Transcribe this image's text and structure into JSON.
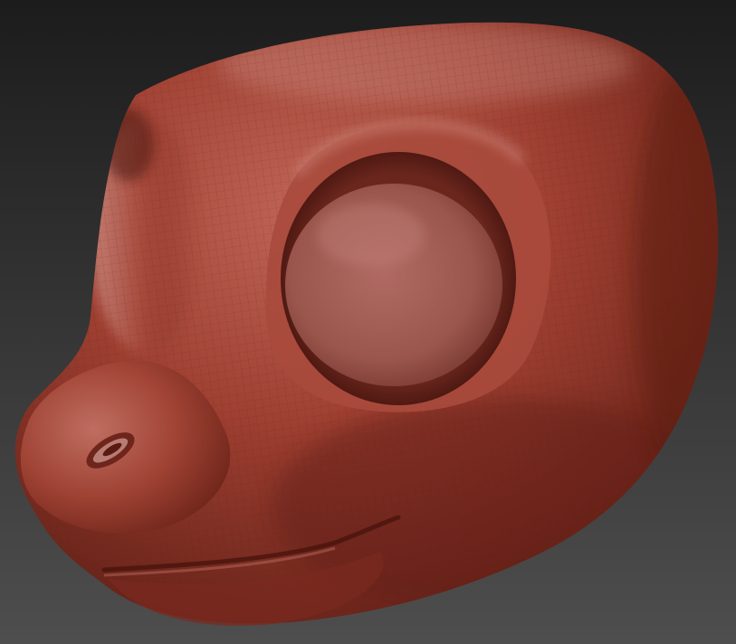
{
  "viewport": {
    "background_top": "#1c1c1c",
    "background_bottom": "#4e4e4e"
  },
  "model": {
    "material_base": "#9e3f31",
    "material_shadow": "#5c1d14",
    "material_highlight": "#cf8b80",
    "wireframe": "#5a1f16"
  }
}
